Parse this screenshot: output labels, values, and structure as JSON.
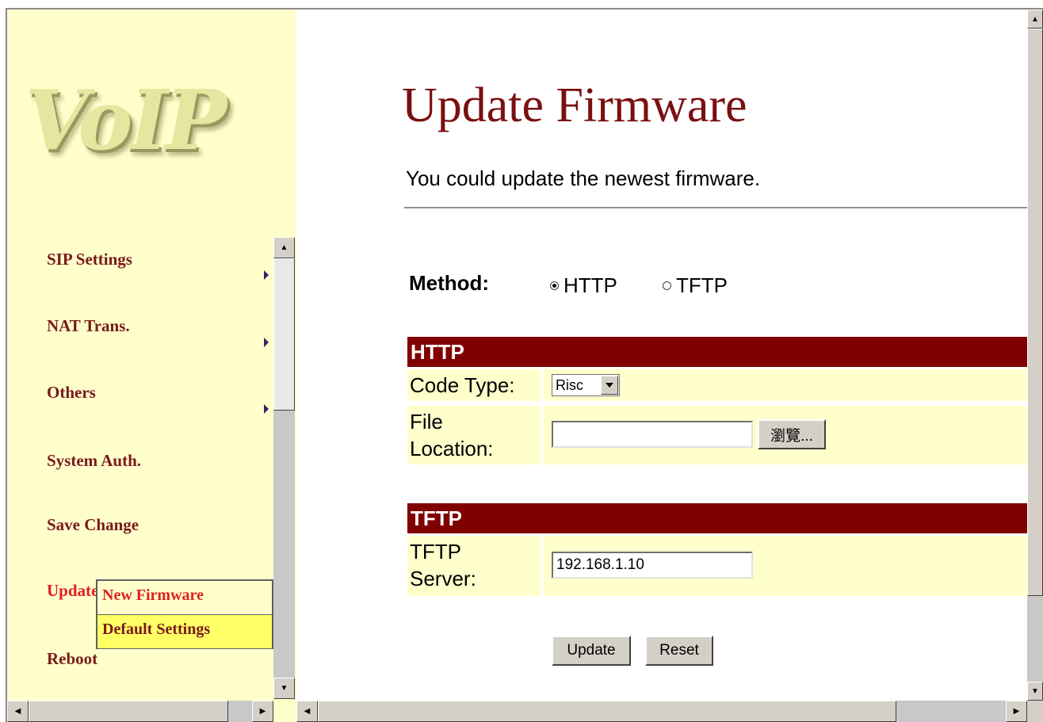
{
  "logo": {
    "text": "VoIP"
  },
  "menu": {
    "items": [
      {
        "label": "SIP Settings"
      },
      {
        "label": "NAT Trans."
      },
      {
        "label": "Others"
      },
      {
        "label": "System Auth."
      },
      {
        "label": "Save Change"
      },
      {
        "label": "Update"
      },
      {
        "label": "Reboot"
      }
    ],
    "submenu": [
      {
        "label": "New Firmware"
      },
      {
        "label": "Default Settings"
      }
    ]
  },
  "page": {
    "title": "Update Firmware",
    "subtitle": "You could update the newest firmware."
  },
  "method": {
    "label": "Method:",
    "options": [
      {
        "label": "HTTP",
        "selected": true
      },
      {
        "label": "TFTP",
        "selected": false
      }
    ]
  },
  "http": {
    "header": "HTTP",
    "code_type_label": "Code Type:",
    "code_type_value": "Risc",
    "file_location_label_1": "File",
    "file_location_label_2": "Location:",
    "file_location_value": "",
    "browse_label": "瀏覽..."
  },
  "tftp": {
    "header": "TFTP",
    "server_label_1": "TFTP",
    "server_label_2": "Server:",
    "server_value": "192.168.1.10"
  },
  "actions": {
    "update_label": "Update",
    "reset_label": "Reset"
  },
  "colors": {
    "menu_bg": "#ffffcc",
    "section_header": "#800000",
    "title": "#7a1010",
    "active_menu": "#e02020",
    "menu_text": "#7a1a1a"
  }
}
